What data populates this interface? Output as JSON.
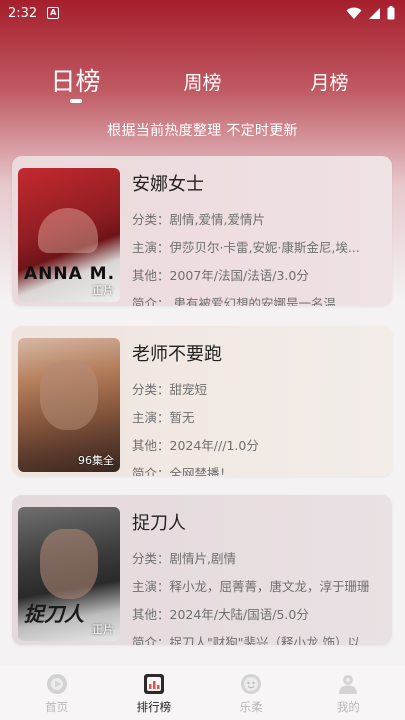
{
  "status": {
    "time": "2:32"
  },
  "tabs": [
    {
      "label": "日榜",
      "active": true
    },
    {
      "label": "周榜",
      "active": false
    },
    {
      "label": "月榜",
      "active": false
    }
  ],
  "subtitle": "根据当前热度整理 不定时更新",
  "items": [
    {
      "title": "安娜女士",
      "genre": "分类：剧情,爱情,爱情片",
      "cast": "主演：伊莎贝尔·卡雷,安妮·康斯金尼,埃...",
      "other": "其他：2007年/法国/法语/3.0分",
      "intro": "简介：       患有被爱幻想的安娜是一名温...",
      "poster_title": "ANNA M.",
      "badge": "正片"
    },
    {
      "title": "老师不要跑",
      "genre": "分类：甜宠短",
      "cast": "主演：暂无",
      "other": "其他：2024年///1.0分",
      "intro": "简介：全网禁播！",
      "badge": "96集全"
    },
    {
      "title": "捉刀人",
      "genre": "分类：剧情片,剧情",
      "cast": "主演：释小龙，屈菁菁，唐文龙，淳于珊珊",
      "other": "其他：2024年/大陆/国语/5.0分",
      "intro": "简介：捉刀人\"财狗\"裴兴（释小龙 饰）以...",
      "poster_title": "捉刀人",
      "badge": "正片"
    }
  ],
  "nav": [
    {
      "label": "首页",
      "icon": "home-icon",
      "active": false
    },
    {
      "label": "排行榜",
      "icon": "ranking-icon",
      "active": true
    },
    {
      "label": "乐柔",
      "icon": "face-icon",
      "active": false
    },
    {
      "label": "我的",
      "icon": "profile-icon",
      "active": false
    }
  ],
  "colors": {
    "header_top": "#a61e2c",
    "background": "#f4f2f3",
    "active_text": "#222222",
    "inactive_text": "#b9b9b9"
  }
}
